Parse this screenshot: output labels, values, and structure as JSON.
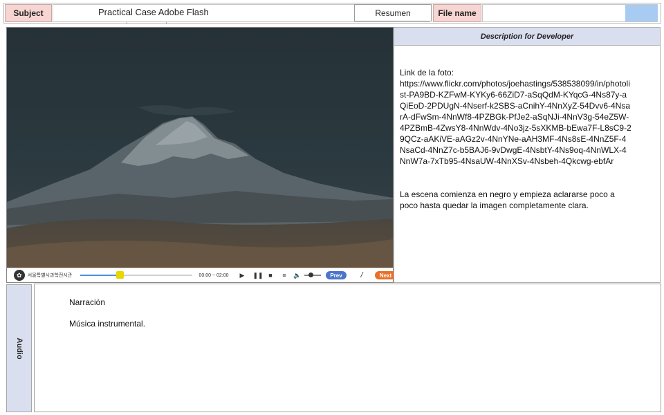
{
  "header": {
    "subject_label": "Subject",
    "subject_value": "Practical Case Adobe Flash",
    "resumen_button": "Resumen",
    "file_name_label": "File name",
    "file_name_value": "",
    "accent_color": "#a8ccf1"
  },
  "player": {
    "logo_text": "서울특별시과학전시관",
    "time_display": "00:00 ~ 02:00",
    "progress_fraction": 0.35,
    "play_icon": "play-icon",
    "pause_icon": "pause-icon",
    "stop_icon": "stop-icon",
    "list_icon": "list-icon",
    "volume_icon": "volume-icon",
    "prev_label": "Prev",
    "separator": "/",
    "next_label": "Next",
    "prev_color": "#4a76c9",
    "next_color": "#e9702a"
  },
  "description": {
    "title": "Description for Developer",
    "link_label": "Link de la foto:",
    "link_url": "https://www.flickr.com/photos/joehastings/538538099/in/photolist-PA9BD-KZFwM-KYKy6-66ZiD7-aSqQdM-KYqcG-4Ns87y-aQiEoD-2PDUgN-4Nserf-k2SBS-aCnihY-4NnXyZ-54Dvv6-4NsarA-dFwSm-4NnWf8-4PZBGk-PfJe2-aSqNJi-4NnV3g-54eZ5W-4PZBmB-4ZwsY8-4NnWdv-4No3jz-5sXKMB-bEwa7F-L8sC9-29QCz-aAKiVE-aAGz2v-4NnYNe-aAH3MF-4Ns8sE-4NnZ5F-4NsaCd-4NnZ7c-b5BAJ6-9vDwgE-4NsbtY-4Ns9oq-4NnWLX-4NnW7a-7xTb95-4NsaUW-4NnXSv-4Nsbeh-4Qkcwg-ebfAr",
    "note": "La escena comienza en negro y empieza aclararse poco a poco hasta quedar la imagen completamente clara."
  },
  "audio": {
    "label": "Audio",
    "lines": [
      "Narración",
      "Música instrumental."
    ]
  }
}
